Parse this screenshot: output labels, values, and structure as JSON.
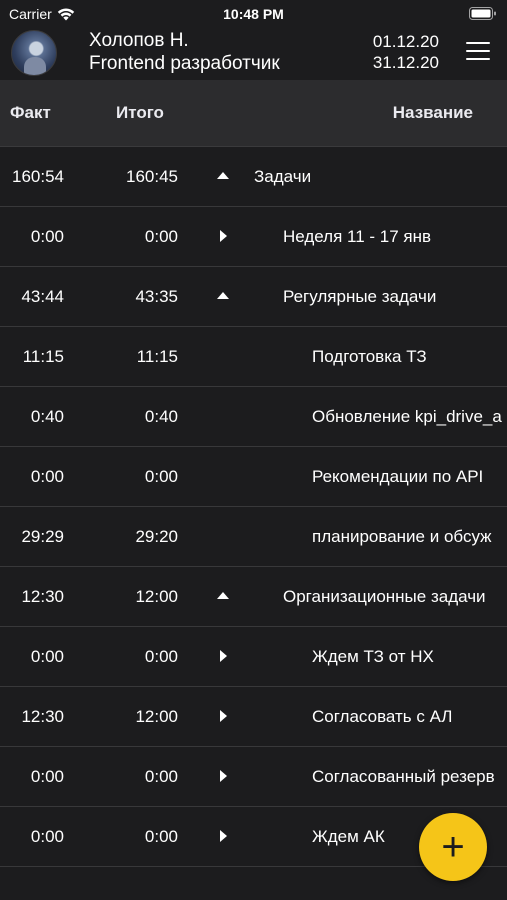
{
  "status": {
    "carrier": "Carrier",
    "time": "10:48 PM"
  },
  "header": {
    "user_name": "Холопов Н.",
    "user_role": "Frontend разработчик",
    "date_from": "01.12.20",
    "date_to": "31.12.20"
  },
  "columns": {
    "fact": "Факт",
    "total": "Итого",
    "name": "Название"
  },
  "rows": [
    {
      "fact": "160:54",
      "total": "160:45",
      "toggle": "up",
      "level": 0,
      "name": "Задачи"
    },
    {
      "fact": "0:00",
      "total": "0:00",
      "toggle": "right",
      "level": 1,
      "name": "Неделя 11 - 17 янв"
    },
    {
      "fact": "43:44",
      "total": "43:35",
      "toggle": "up",
      "level": 1,
      "name": "Регулярные задачи"
    },
    {
      "fact": "11:15",
      "total": "11:15",
      "toggle": "none",
      "level": 2,
      "name": "Подготовка ТЗ"
    },
    {
      "fact": "0:40",
      "total": "0:40",
      "toggle": "none",
      "level": 2,
      "name": "Обновление kpi_drive_a"
    },
    {
      "fact": "0:00",
      "total": "0:00",
      "toggle": "none",
      "level": 2,
      "name": "Рекомендации по API"
    },
    {
      "fact": "29:29",
      "total": "29:20",
      "toggle": "none",
      "level": 2,
      "name": "планирование и обсуж"
    },
    {
      "fact": "12:30",
      "total": "12:00",
      "toggle": "up",
      "level": 1,
      "name": "Организационные задачи"
    },
    {
      "fact": "0:00",
      "total": "0:00",
      "toggle": "right",
      "level": 2,
      "name": "Ждем ТЗ от НХ"
    },
    {
      "fact": "12:30",
      "total": "12:00",
      "toggle": "right",
      "level": 2,
      "name": "Согласовать с АЛ"
    },
    {
      "fact": "0:00",
      "total": "0:00",
      "toggle": "right",
      "level": 2,
      "name": "Согласованный резерв"
    },
    {
      "fact": "0:00",
      "total": "0:00",
      "toggle": "right",
      "level": 2,
      "name": "Ждем АК"
    }
  ],
  "fab": {
    "label": "+",
    "color": "#f5c518"
  },
  "icons": {
    "wifi": "wifi-icon",
    "battery": "battery-icon",
    "menu": "hamburger-menu-icon",
    "expanded": "triangle-up-icon",
    "collapsed": "triangle-right-icon",
    "add": "plus-icon"
  }
}
